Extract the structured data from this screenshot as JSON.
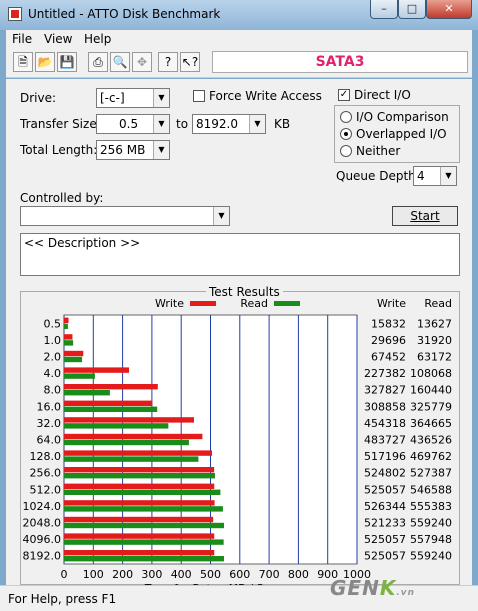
{
  "window": {
    "title": "Untitled - ATTO Disk Benchmark"
  },
  "menu": [
    "File",
    "View",
    "Help"
  ],
  "toolbar": {
    "banner": "SATA3"
  },
  "form": {
    "drive_label": "Drive:",
    "drive_value": "[-c-]",
    "force_write_label": "Force Write Access",
    "transfer_size_label": "Transfer Size:",
    "transfer_from": "0.5",
    "to_label": "to",
    "transfer_to": "8192.0",
    "kb_label": "KB",
    "total_length_label": "Total Length:",
    "total_length_value": "256 MB",
    "direct_io_label": "Direct I/O",
    "direct_io_checked": true,
    "io_comparison_label": "I/O Comparison",
    "overlapped_io_label": "Overlapped I/O",
    "neither_label": "Neither",
    "selected_mode": "Overlapped I/O",
    "queue_depth_label": "Queue Depth:",
    "queue_depth_value": "4",
    "controlled_by_label": "Controlled by:",
    "controlled_by_value": "",
    "start_label": "Start",
    "description": "<< Description >>"
  },
  "results": {
    "title": "Test Results",
    "write_col": "Write",
    "read_col": "Read"
  },
  "chart_data": {
    "type": "bar",
    "orientation": "horizontal",
    "title": "",
    "xlabel": "Transfer Rate - MB / Sec",
    "ylabel": "",
    "xlim": [
      0,
      1000
    ],
    "xticks": [
      "0",
      "100",
      "200",
      "300",
      "400",
      "500",
      "600",
      "700",
      "800",
      "900",
      "1000"
    ],
    "grid": true,
    "legend_position": "top",
    "categories": [
      "0.5",
      "1.0",
      "2.0",
      "4.0",
      "8.0",
      "16.0",
      "32.0",
      "64.0",
      "128.0",
      "256.0",
      "512.0",
      "1024.0",
      "2048.0",
      "4096.0",
      "8192.0"
    ],
    "series": [
      {
        "name": "Write",
        "color": "#e31b1b",
        "values": [
          15.5,
          28.9,
          65.9,
          222.0,
          320.1,
          301.6,
          443.7,
          472.4,
          505.1,
          512.5,
          512.8,
          514.0,
          509.0,
          512.8,
          512.8
        ]
      },
      {
        "name": "Read",
        "color": "#1a8c1a",
        "values": [
          13.3,
          31.2,
          61.7,
          105.5,
          156.7,
          318.1,
          356.1,
          426.4,
          458.7,
          515.2,
          533.8,
          542.4,
          546.1,
          544.9,
          546.1
        ]
      }
    ],
    "table": {
      "write": [
        "15832",
        "29696",
        "67452",
        "227382",
        "327827",
        "308858",
        "454318",
        "483727",
        "517196",
        "524802",
        "525057",
        "526344",
        "521233",
        "525057",
        "525057"
      ],
      "read": [
        "13627",
        "31920",
        "63172",
        "108068",
        "160440",
        "325779",
        "364665",
        "436526",
        "469762",
        "527387",
        "546588",
        "555383",
        "559240",
        "557948",
        "559240"
      ]
    }
  },
  "status": {
    "text": "For Help, press F1"
  },
  "watermark": {
    "text": "GENK.vn"
  }
}
